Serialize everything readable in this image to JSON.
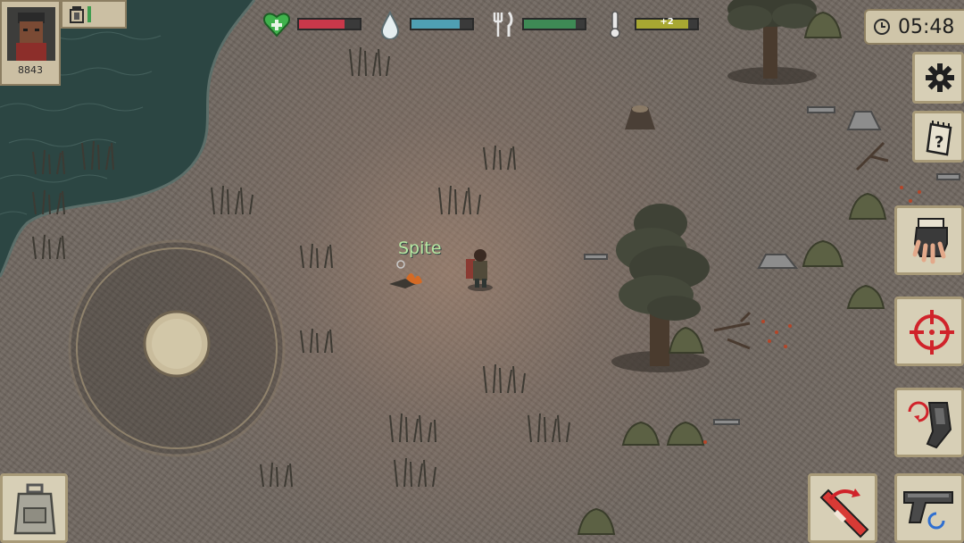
{
  "player": {
    "id_number": "8843",
    "name_label": "Spite"
  },
  "status_bars": {
    "health": {
      "icon": "heart-plus-icon",
      "level": 0.75,
      "color": "#c9384a"
    },
    "thirst": {
      "icon": "water-drop-icon",
      "level": 0.8,
      "color": "#4f9fb3"
    },
    "hunger": {
      "icon": "fork-knife-icon",
      "level": 0.85,
      "color": "#3e8a55"
    },
    "temperature": {
      "icon": "thermometer-icon",
      "level": 0.85,
      "color": "#a8a832",
      "text": "+2"
    }
  },
  "clock": {
    "time": "05:48",
    "icon": "clock-icon"
  },
  "buttons": {
    "settings": {
      "icon": "gear-icon"
    },
    "journal": {
      "icon": "notepad-question-icon"
    },
    "interact": {
      "icon": "grab-hand-icon"
    },
    "aim": {
      "icon": "crosshair-icon"
    },
    "reload": {
      "icon": "reload-magazine-icon"
    },
    "swap_weapon": {
      "icon": "flare-swap-icon"
    },
    "weapon": {
      "icon": "pistol-icon"
    },
    "inventory": {
      "icon": "backpack-icon"
    },
    "light": {
      "icon": "lantern-icon"
    }
  },
  "colors": {
    "ground": "#716861",
    "water": "#2f4845",
    "ui_panel": "#d7cfb6"
  }
}
